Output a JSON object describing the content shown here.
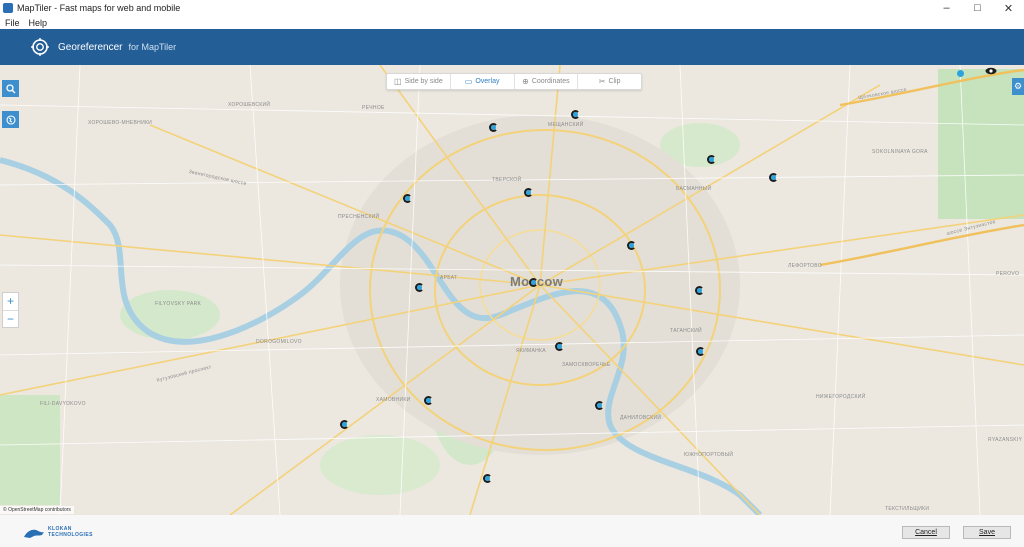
{
  "window": {
    "title": "MapTiler - Fast maps for web and mobile",
    "controls": {
      "minimize": "–",
      "maximize": "□",
      "close": "✕"
    }
  },
  "menu": {
    "items": [
      "File",
      "Help"
    ]
  },
  "header": {
    "app_name": "Georeferencer",
    "app_sub": "for MapTiler"
  },
  "tabs": [
    {
      "label": "Side by side",
      "icon": "side-by-side-icon",
      "icon_glyph": "◫"
    },
    {
      "label": "Overlay",
      "icon": "overlay-icon",
      "icon_glyph": "▭"
    },
    {
      "label": "Coordinates",
      "icon": "crosshair-icon",
      "icon_glyph": "⊕"
    },
    {
      "label": "Clip",
      "icon": "scissors-icon",
      "icon_glyph": "✂"
    }
  ],
  "active_tab": "Overlay",
  "map": {
    "city": "Moscow",
    "labels": [
      "ХОРОШЕВО-МНЕВНИКИ",
      "ХОРОШЕВСКИЙ",
      "РЕЧНОЕ",
      "МЕЩАНСКИЙ",
      "БАСМАННЫЙ",
      "SOKOLNINAYA GORA",
      "ПРЕСНЕНСКИЙ",
      "ТВЕРСКОЙ",
      "АРБАТ",
      "ЛЕФОРТОВО",
      "PEROVO",
      "FILYOVSKY PARK",
      "DOROGOMILOVO",
      "ЯКИМАНКА",
      "ЗАМОСКВОРЕЧЬЕ",
      "ТАГАНСКИЙ",
      "FILI-DAVYDKOVO",
      "ХАМОВНИКИ",
      "НИЖЕГОРОДСКИЙ",
      "ДАНИЛОВСКИЙ",
      "RYAZANSKIY",
      "ЮЖНОПОРТОВЫЙ",
      "ТЕКСТИЛЬЩИКИ",
      "Звенигородское шоссе",
      "Кутузовский проспект",
      "шоссе Энтузиастов",
      "Щёлковское шоссе"
    ],
    "attribution": "© OpenStreetMap contributors",
    "accent": "#3d8fce",
    "gcp_count": 20
  },
  "controls": {
    "search_icon": "search-icon",
    "globe_icon": "globe-icon",
    "settings_icon": "gear-icon",
    "eye_icon": "eye-icon",
    "zoom_in": "+",
    "zoom_out": "−"
  },
  "footer": {
    "brand_line1": "KLOKAN",
    "brand_line2": "TECHNOLOGIES",
    "cancel": "Cancel",
    "save": "Save"
  },
  "colors": {
    "header": "#245e97",
    "accent": "#3d8fce"
  }
}
